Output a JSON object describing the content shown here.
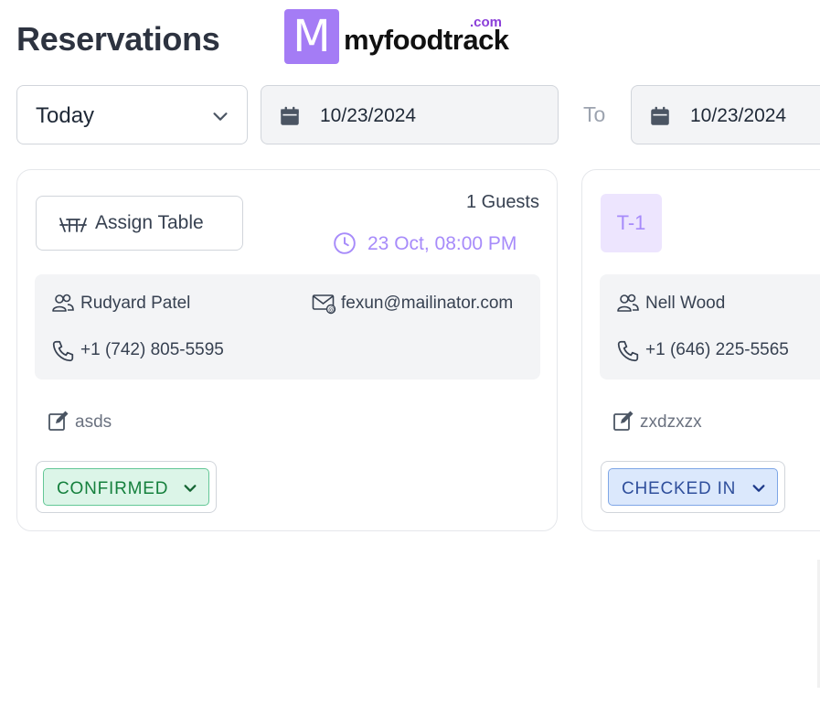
{
  "header": {
    "title": "Reservations",
    "brand": {
      "mark": "M",
      "name": "myfoodtrack",
      "tld": ".com"
    }
  },
  "filters": {
    "range_select": "Today",
    "from_date": "10/23/2024",
    "to_label": "To",
    "to_date": "10/23/2024"
  },
  "reservations": [
    {
      "assign_label": "Assign Table",
      "guests": "1 Guests",
      "datetime": "23 Oct, 08:00 PM",
      "name": "Rudyard Patel",
      "email": "fexun@mailinator.com",
      "phone": "+1 (742) 805-5595",
      "note": "asds",
      "status": "CONFIRMED"
    },
    {
      "table": "T-1",
      "name": "Nell Wood",
      "phone": "+1 (646) 225-5565",
      "note": "zxdzxzx",
      "status": "CHECKED IN"
    }
  ],
  "colors": {
    "brand": "#a47cf5",
    "accent_purple": "#a78bfa",
    "confirmed_bg": "#dcf5e8",
    "confirmed_text": "#15803d",
    "checked_bg": "#dbe8fc",
    "checked_text": "#2f4f9c"
  },
  "icons": {
    "select_chevron": "chevron-down-icon",
    "date": "calendar-icon",
    "assign": "table-icon",
    "time": "clock-icon",
    "guest": "users-icon",
    "email": "mail-icon",
    "phone": "phone-icon",
    "note": "edit-icon"
  }
}
